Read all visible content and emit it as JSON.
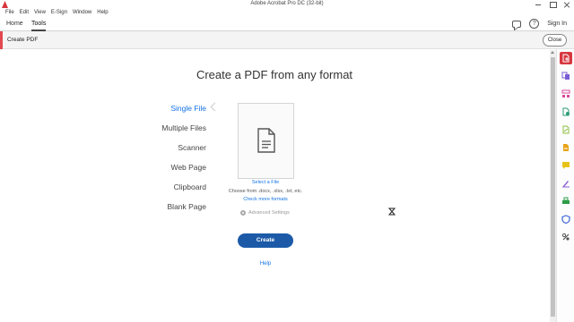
{
  "window": {
    "title": "Adobe Acrobat Pro DC (32-bit)"
  },
  "menu": [
    "File",
    "Edit",
    "View",
    "E-Sign",
    "Window",
    "Help"
  ],
  "nav": {
    "tabs": [
      "Home",
      "Tools"
    ],
    "active_tab": "Tools",
    "sign_in": "Sign In",
    "help_glyph": "?"
  },
  "tool": {
    "title": "Create PDF",
    "close_label": "Close"
  },
  "main": {
    "heading": "Create a PDF from any format",
    "formats": [
      "Single File",
      "Multiple Files",
      "Scanner",
      "Web Page",
      "Clipboard",
      "Blank Page"
    ],
    "selected_format": "Single File",
    "select_file": "Select a File",
    "choose_from": "Choose from .docx, .xlsx, .txt, etc.",
    "more_formats": "Check more formats",
    "advanced_settings": "Advanced Settings",
    "create_label": "Create",
    "help_label": "Help"
  },
  "rail": {
    "items": [
      {
        "icon": "create-pdf-icon",
        "color": "#ffffff",
        "active": true
      },
      {
        "icon": "combine-files-icon",
        "color": "#7b5cd6"
      },
      {
        "icon": "organize-pages-icon",
        "color": "#d94b9b"
      },
      {
        "icon": "export-pdf-icon",
        "color": "#2d9d78"
      },
      {
        "icon": "edit-pdf-icon",
        "color": "#8cbf3f"
      },
      {
        "icon": "scan-ocr-icon",
        "color": "#e8a317"
      },
      {
        "icon": "comment-icon",
        "color": "#e8c317"
      },
      {
        "icon": "fill-sign-icon",
        "color": "#8a5cd6"
      },
      {
        "icon": "print-production-icon",
        "color": "#2d9d48"
      },
      {
        "icon": "protect-icon",
        "color": "#3b63d6"
      },
      {
        "icon": "more-tools-icon",
        "color": "#555555"
      }
    ]
  },
  "colors": {
    "accent": "#1473e6",
    "create_button": "#1c5aa8",
    "tool_accent": "#e34850"
  }
}
